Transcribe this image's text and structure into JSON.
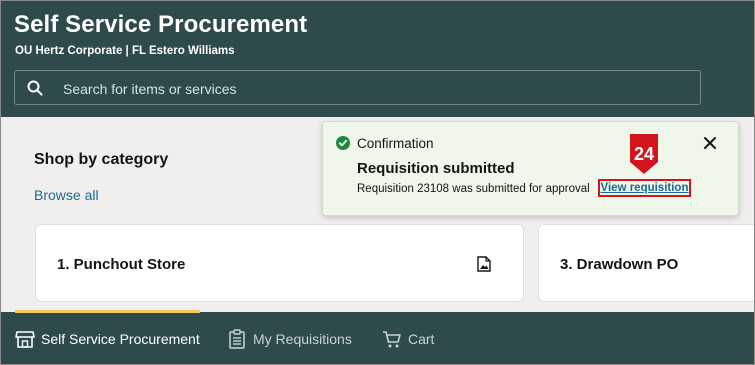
{
  "header": {
    "title": "Self Service Procurement",
    "subtitle": "OU Hertz Corporate | FL Estero Williams"
  },
  "search": {
    "placeholder": "Search for items or services",
    "value": ""
  },
  "main": {
    "section_title": "Shop by category",
    "browse_all": "Browse all",
    "cards": [
      {
        "label": "1. Punchout Store",
        "icon": "image-document-icon"
      },
      {
        "label": "3. Drawdown PO"
      }
    ]
  },
  "toast": {
    "kind": "Confirmation",
    "heading": "Requisition submitted",
    "message": "Requisition 23108 was submitted for approval",
    "link": "View requisition",
    "step_number": "24"
  },
  "bottom_nav": {
    "items": [
      {
        "label": "Self Service Procurement",
        "icon": "store-icon"
      },
      {
        "label": "My Requisitions",
        "icon": "clipboard-list-icon"
      },
      {
        "label": "Cart",
        "icon": "cart-icon"
      }
    ]
  },
  "colors": {
    "header_bg": "#2e4a4a",
    "content_bg": "#f1efed",
    "toast_bg": "#eef7e9",
    "success": "#1e8a3c",
    "link": "#1c6a94",
    "highlight": "#d4141d",
    "nav_indicator": "#f6c85f"
  }
}
